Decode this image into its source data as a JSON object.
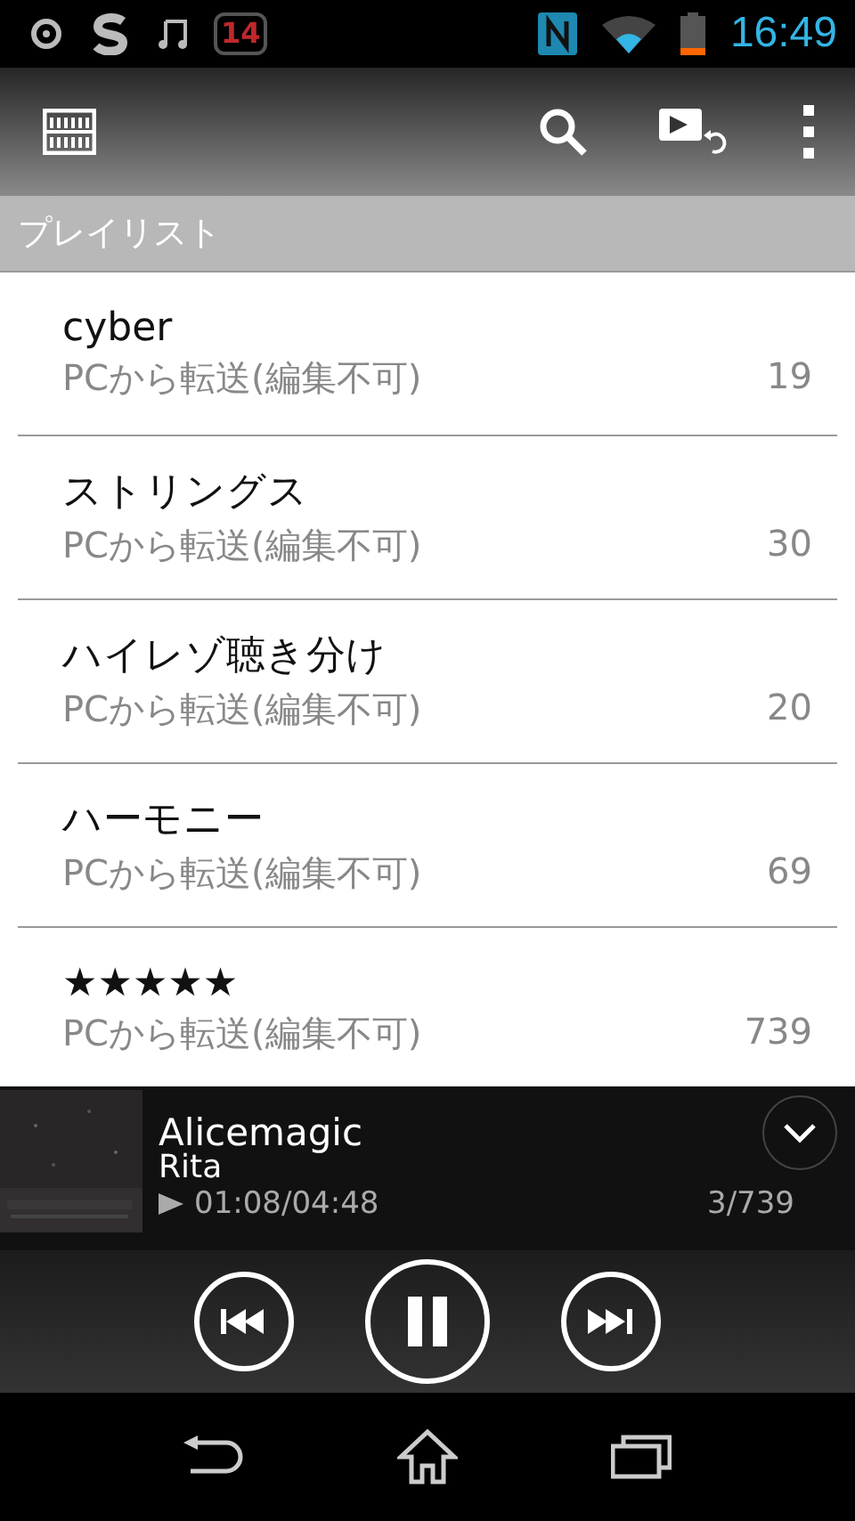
{
  "status_bar": {
    "badge": "14",
    "time": "16:49"
  },
  "section_header": "プレイリスト",
  "playlists": [
    {
      "title": "cyber",
      "subtitle": "PCから転送(編集不可)",
      "count": "19"
    },
    {
      "title": "ストリングス",
      "subtitle": "PCから転送(編集不可)",
      "count": "30"
    },
    {
      "title": "ハイレゾ聴き分け",
      "subtitle": "PCから転送(編集不可)",
      "count": "20"
    },
    {
      "title": "ハーモニー",
      "subtitle": "PCから転送(編集不可)",
      "count": "69"
    },
    {
      "title": "★★★★★",
      "subtitle": "PCから転送(編集不可)",
      "count": "739"
    }
  ],
  "now_playing": {
    "title": "Alicemagic",
    "artist": "Rita",
    "time": "01:08/04:48",
    "position": "3/739",
    "playing": true
  }
}
